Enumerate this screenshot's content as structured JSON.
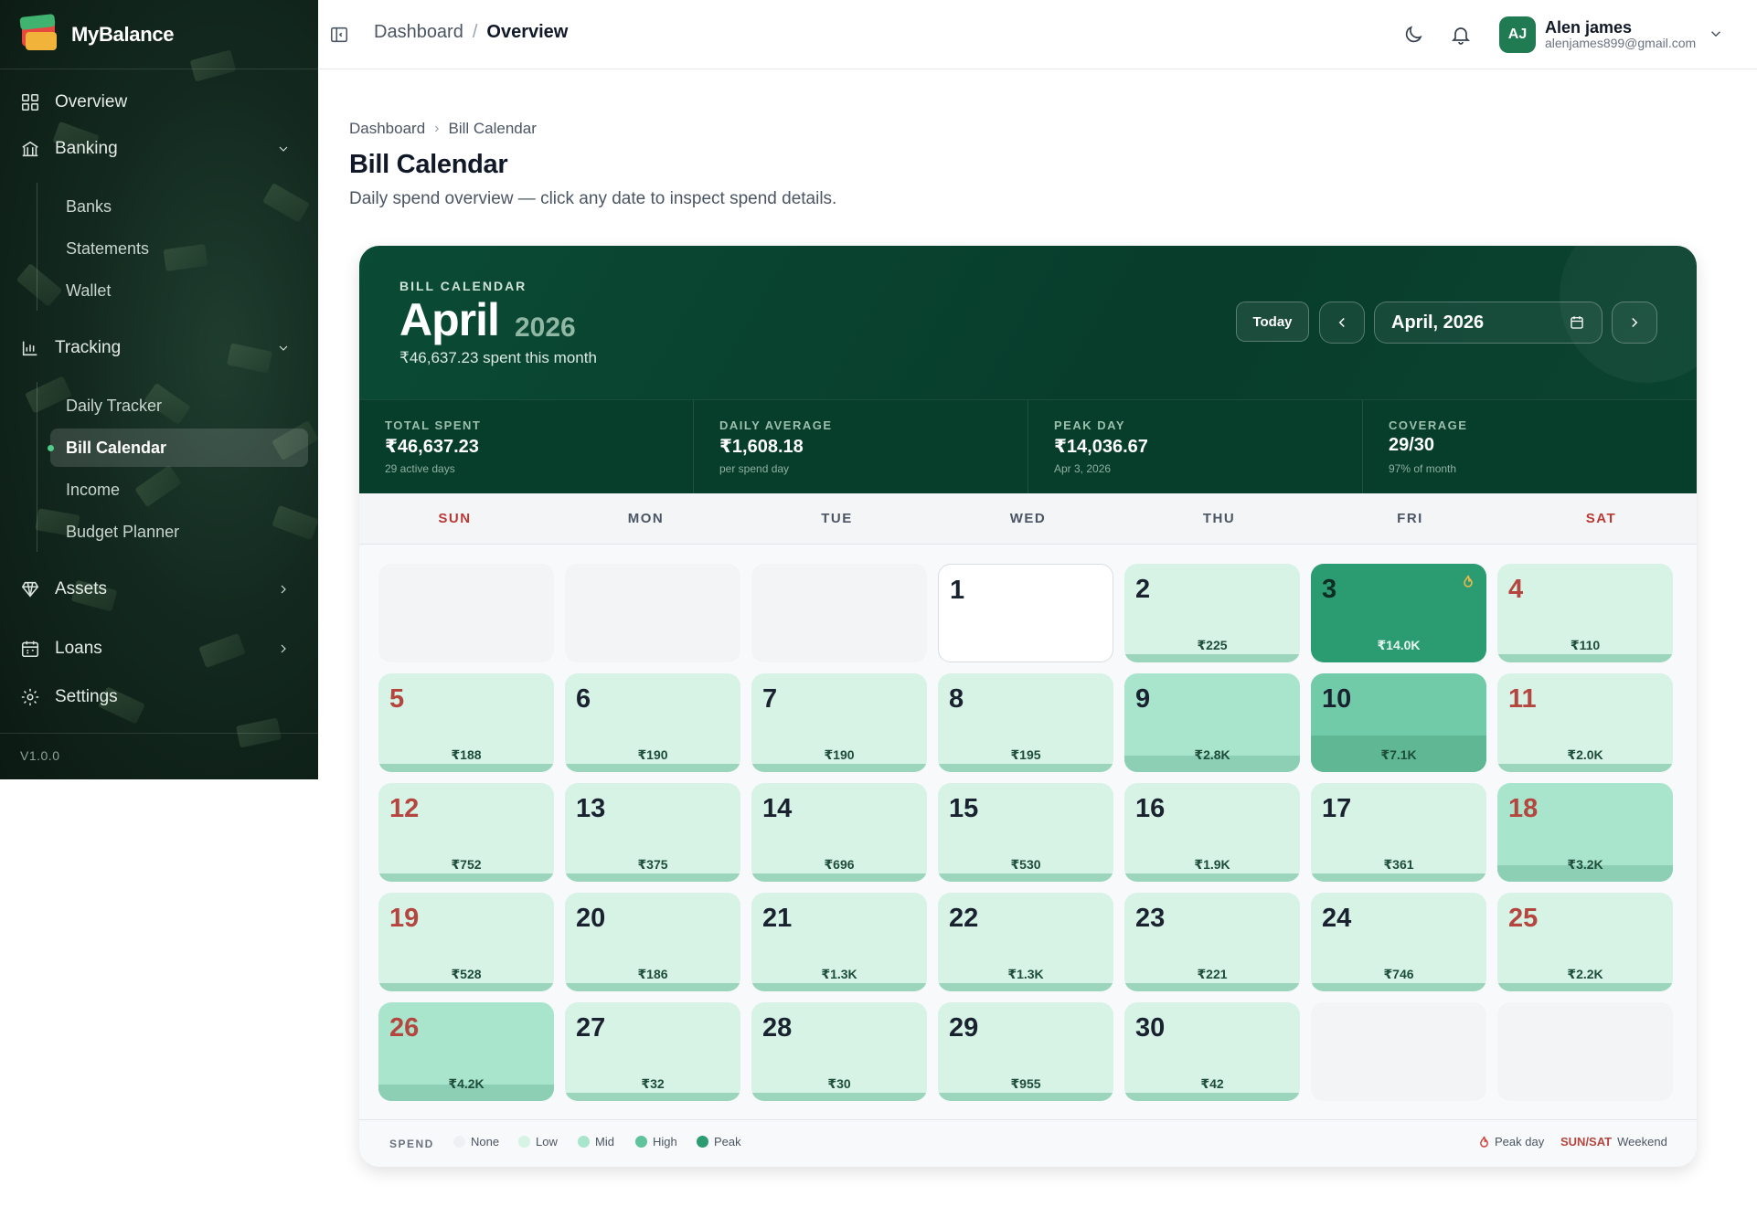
{
  "app": {
    "name": "MyBalance",
    "version": "V1.0.0"
  },
  "sidebar": {
    "overview": "Overview",
    "banking": {
      "label": "Banking",
      "items": [
        "Banks",
        "Statements",
        "Wallet"
      ]
    },
    "tracking": {
      "label": "Tracking",
      "items": [
        "Daily Tracker",
        "Bill Calendar",
        "Income",
        "Budget Planner"
      ],
      "active": "Bill Calendar"
    },
    "assets": "Assets",
    "loans": "Loans",
    "settings": "Settings"
  },
  "topbar": {
    "crumb_root": "Dashboard",
    "crumb_sep": "/",
    "crumb_current": "Overview",
    "user": {
      "initials": "AJ",
      "name": "Alen james",
      "email": "alenjames899@gmail.com"
    }
  },
  "page": {
    "crumb_root": "Dashboard",
    "crumb_current": "Bill Calendar",
    "title": "Bill Calendar",
    "subtitle": "Daily spend overview — click any date to inspect spend details."
  },
  "calendar": {
    "eyebrow": "BILL CALENDAR",
    "month": "April",
    "year": "2026",
    "spent_text": "₹46,637.23 spent this month",
    "today_label": "Today",
    "picker_value": "April, 2026",
    "stats": [
      {
        "label": "TOTAL SPENT",
        "value": "₹46,637.23",
        "sub": "29 active days"
      },
      {
        "label": "DAILY AVERAGE",
        "value": "₹1,608.18",
        "sub": "per spend day"
      },
      {
        "label": "PEAK DAY",
        "value": "₹14,036.67",
        "sub": "Apr 3, 2026"
      },
      {
        "label": "COVERAGE",
        "value": "29/30",
        "sub": "97% of month"
      }
    ],
    "weekdays": [
      "SUN",
      "MON",
      "TUE",
      "WED",
      "THU",
      "FRI",
      "SAT"
    ],
    "leading_blanks": 3,
    "trailing_blanks": 2,
    "days": [
      {
        "d": "1",
        "amt": "",
        "level": "none"
      },
      {
        "d": "2",
        "amt": "₹225",
        "level": "low"
      },
      {
        "d": "3",
        "amt": "₹14.0K",
        "level": "peak",
        "peak": true
      },
      {
        "d": "4",
        "amt": "₹110",
        "level": "low"
      },
      {
        "d": "5",
        "amt": "₹188",
        "level": "low"
      },
      {
        "d": "6",
        "amt": "₹190",
        "level": "low"
      },
      {
        "d": "7",
        "amt": "₹190",
        "level": "low"
      },
      {
        "d": "8",
        "amt": "₹195",
        "level": "low"
      },
      {
        "d": "9",
        "amt": "₹2.8K",
        "level": "mid"
      },
      {
        "d": "10",
        "amt": "₹7.1K",
        "level": "high"
      },
      {
        "d": "11",
        "amt": "₹2.0K",
        "level": "low"
      },
      {
        "d": "12",
        "amt": "₹752",
        "level": "low"
      },
      {
        "d": "13",
        "amt": "₹375",
        "level": "low"
      },
      {
        "d": "14",
        "amt": "₹696",
        "level": "low"
      },
      {
        "d": "15",
        "amt": "₹530",
        "level": "low"
      },
      {
        "d": "16",
        "amt": "₹1.9K",
        "level": "low"
      },
      {
        "d": "17",
        "amt": "₹361",
        "level": "low"
      },
      {
        "d": "18",
        "amt": "₹3.2K",
        "level": "mid"
      },
      {
        "d": "19",
        "amt": "₹528",
        "level": "low"
      },
      {
        "d": "20",
        "amt": "₹186",
        "level": "low"
      },
      {
        "d": "21",
        "amt": "₹1.3K",
        "level": "low"
      },
      {
        "d": "22",
        "amt": "₹1.3K",
        "level": "low"
      },
      {
        "d": "23",
        "amt": "₹221",
        "level": "low"
      },
      {
        "d": "24",
        "amt": "₹746",
        "level": "low"
      },
      {
        "d": "25",
        "amt": "₹2.2K",
        "level": "low"
      },
      {
        "d": "26",
        "amt": "₹4.2K",
        "level": "mid"
      },
      {
        "d": "27",
        "amt": "₹32",
        "level": "low"
      },
      {
        "d": "28",
        "amt": "₹30",
        "level": "low"
      },
      {
        "d": "29",
        "amt": "₹955",
        "level": "low"
      },
      {
        "d": "30",
        "amt": "₹42",
        "level": "low"
      }
    ],
    "legend": {
      "title": "SPEND",
      "levels": [
        {
          "label": "None",
          "color": "#eef1f3"
        },
        {
          "label": "Low",
          "color": "#d6f3e6"
        },
        {
          "label": "Mid",
          "color": "#a9e5cc"
        },
        {
          "label": "High",
          "color": "#5fc39b"
        },
        {
          "label": "Peak",
          "color": "#2b9b72"
        }
      ],
      "peak_label": "Peak day",
      "weekend_tag": "SUN/SAT",
      "weekend_label": "Weekend"
    }
  }
}
